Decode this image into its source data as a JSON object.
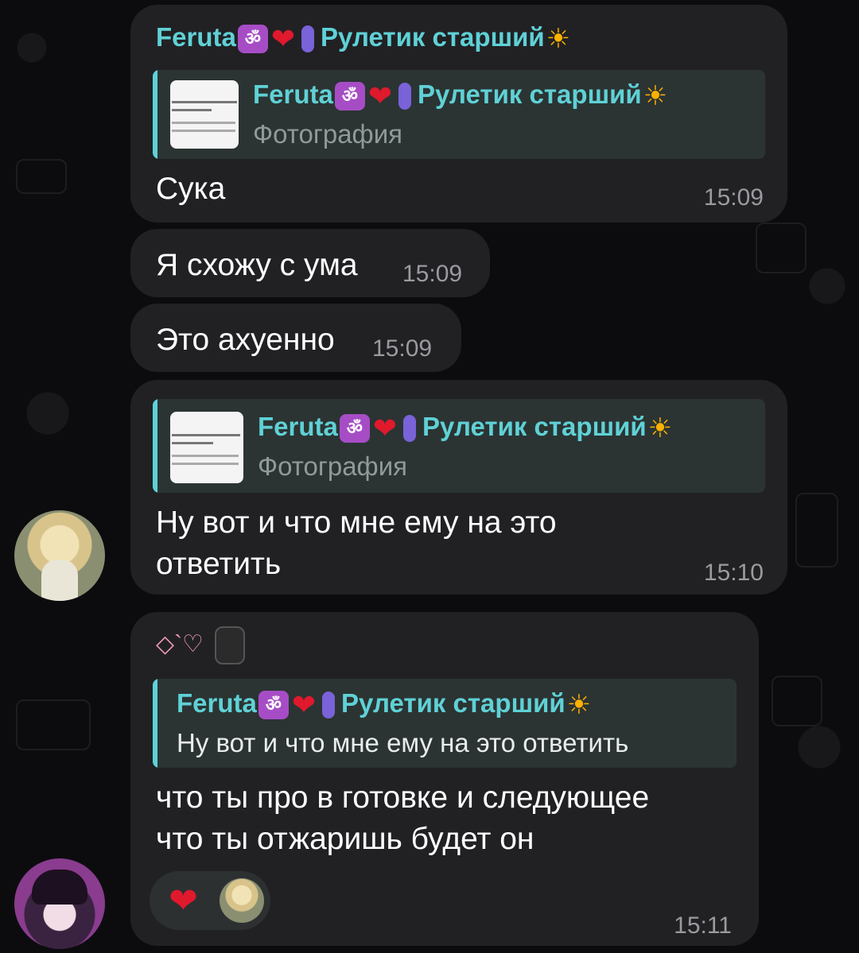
{
  "messages": [
    {
      "sender": "Feruta",
      "reply": {
        "name": "Feruta",
        "suffix": "Рулетик старший",
        "text": "Фотография",
        "thumb_lines": [
          "aiser replied to you on",
          "ddict99's post",
          "Ты суп готовишь? С",
          "литы, а не на поле."
        ]
      },
      "text": "Сука",
      "time": "15:09"
    },
    {
      "text": "Я схожу с ума",
      "time": "15:09"
    },
    {
      "text": "Это ахуенно",
      "time": "15:09"
    },
    {
      "reply": {
        "name": "Feruta",
        "suffix": "Рулетик старший",
        "text": "Фотография",
        "thumb_lines": [
          "aiser replied to you on",
          "ddict99's post",
          "Ты суп готовишь? С",
          "литы, а не на поле."
        ]
      },
      "text_line1": "Ну вот и что мне ему на это",
      "text_line2": "ответить",
      "time": "15:10"
    },
    {
      "sender_decor": "◇`♡",
      "reply": {
        "name": "Feruta",
        "suffix": "Рулетик старший",
        "text": "Ну вот и что мне ему на это ответить"
      },
      "text_line1": "что ты про в готовке и следующее",
      "text_line2": "что ты отжаришь будет он",
      "reactions": [
        "❤"
      ],
      "time": "15:11"
    }
  ],
  "icons": {
    "om": "ॐ",
    "heart": "❤",
    "sun": "☀"
  },
  "colors": {
    "accent": "#5fd1d6",
    "bubble": "#212124",
    "background": "#0c0c0e"
  }
}
